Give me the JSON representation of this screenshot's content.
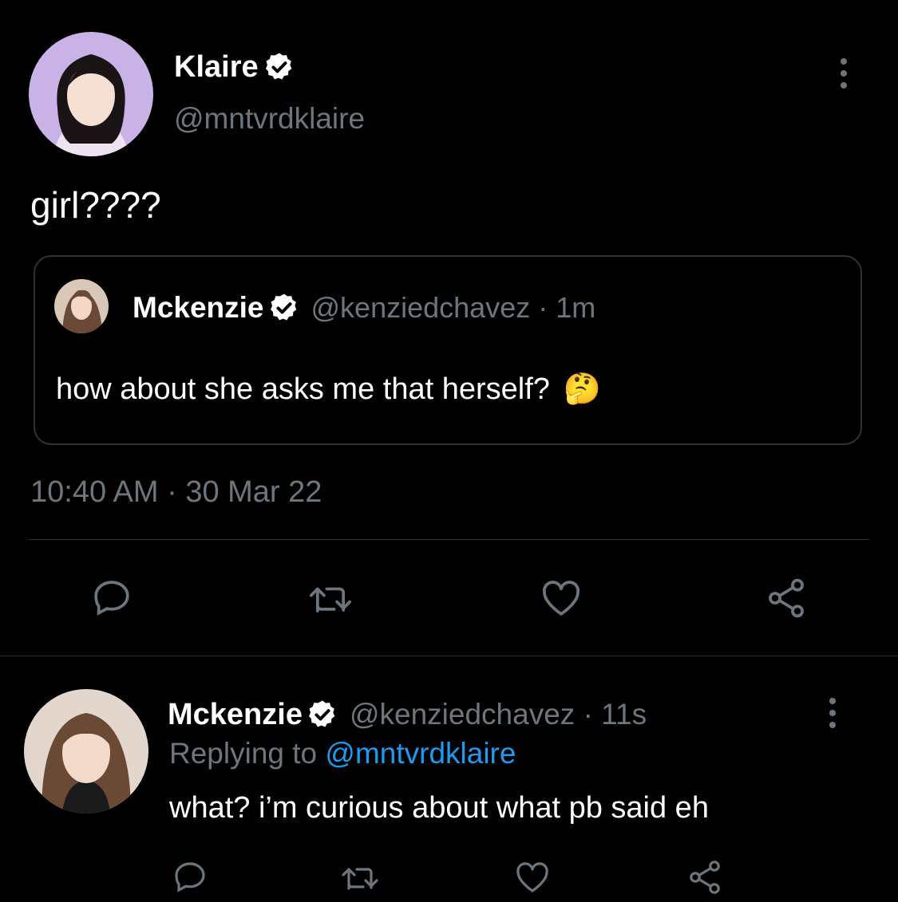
{
  "main_tweet": {
    "display_name": "Klaire",
    "handle": "@mntvrdklaire",
    "text": "girl????",
    "timestamp": "10:40 AM · 30 Mar 22",
    "quoted": {
      "display_name": "Mckenzie",
      "handle_time": "@kenziedchavez · 1m",
      "text": "how about she asks me that herself?",
      "emoji": "🤔"
    },
    "actions": [
      "reply-icon",
      "retweet-icon",
      "like-icon",
      "share-icon"
    ]
  },
  "reply": {
    "display_name": "Mckenzie",
    "handle_time": "@kenziedchavez · 11s",
    "replying_prefix": "Replying to",
    "replying_to": "@mntvrdklaire",
    "text": "what? i’m curious about what pb said eh",
    "actions": [
      "reply-icon",
      "retweet-icon",
      "like-icon",
      "share-icon"
    ]
  },
  "colors": {
    "background": "#000000",
    "muted": "#6e767d",
    "link": "#1d9bf0",
    "divider": "#2f3336",
    "avatar_klaire_bg": "#c9b3e6"
  }
}
